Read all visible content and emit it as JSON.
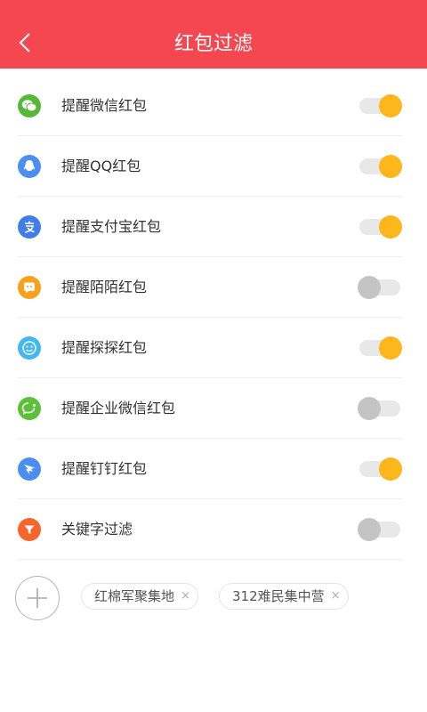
{
  "header": {
    "title": "红包过滤"
  },
  "colors": {
    "header_bg": "#f4474f",
    "toggle_on": "#fdb61b",
    "toggle_off": "#c4c4c4"
  },
  "settings": [
    {
      "label": "提醒微信红包",
      "icon": "wechat-icon",
      "icon_color": "#55b837",
      "enabled": true
    },
    {
      "label": "提醒QQ红包",
      "icon": "qq-icon",
      "icon_color": "#4a8ef0",
      "enabled": true
    },
    {
      "label": "提醒支付宝红包",
      "icon": "alipay-icon",
      "icon_color": "#3f7de8",
      "enabled": true
    },
    {
      "label": "提醒陌陌红包",
      "icon": "momo-icon",
      "icon_color": "#f9a01c",
      "enabled": false
    },
    {
      "label": "提醒探探红包",
      "icon": "tantan-icon",
      "icon_color": "#43b7f2",
      "enabled": true
    },
    {
      "label": "提醒企业微信红包",
      "icon": "wework-icon",
      "icon_color": "#5cc039",
      "enabled": false
    },
    {
      "label": "提醒钉钉红包",
      "icon": "dingtalk-icon",
      "icon_color": "#4a8ef0",
      "enabled": true
    },
    {
      "label": "关键字过滤",
      "icon": "filter-icon",
      "icon_color": "#f7652a",
      "enabled": false
    }
  ],
  "keywords": [
    {
      "text": "红棉军聚集地",
      "remove": "×"
    },
    {
      "text": "312难民集中营",
      "remove": "×"
    }
  ]
}
